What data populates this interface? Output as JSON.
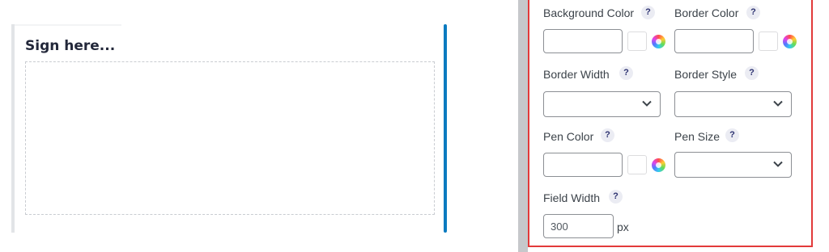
{
  "signature_preview": {
    "title": "Sign here..."
  },
  "settings": {
    "help_glyph": "?",
    "background_color": {
      "label": "Background Color",
      "value": ""
    },
    "border_color": {
      "label": "Border Color",
      "value": ""
    },
    "border_width": {
      "label": "Border Width",
      "selected": ""
    },
    "border_style": {
      "label": "Border Style",
      "selected": ""
    },
    "pen_color": {
      "label": "Pen Color",
      "value": ""
    },
    "pen_size": {
      "label": "Pen Size",
      "selected": ""
    },
    "field_width": {
      "label": "Field Width",
      "value": "300",
      "unit": "px"
    }
  },
  "colors": {
    "accent_bar": "#0a7bc0",
    "highlight_border": "#e23a3a",
    "divider": "#c6c8cb"
  },
  "icons": [
    "help-icon",
    "color-wheel-icon",
    "chevron-down-icon"
  ]
}
